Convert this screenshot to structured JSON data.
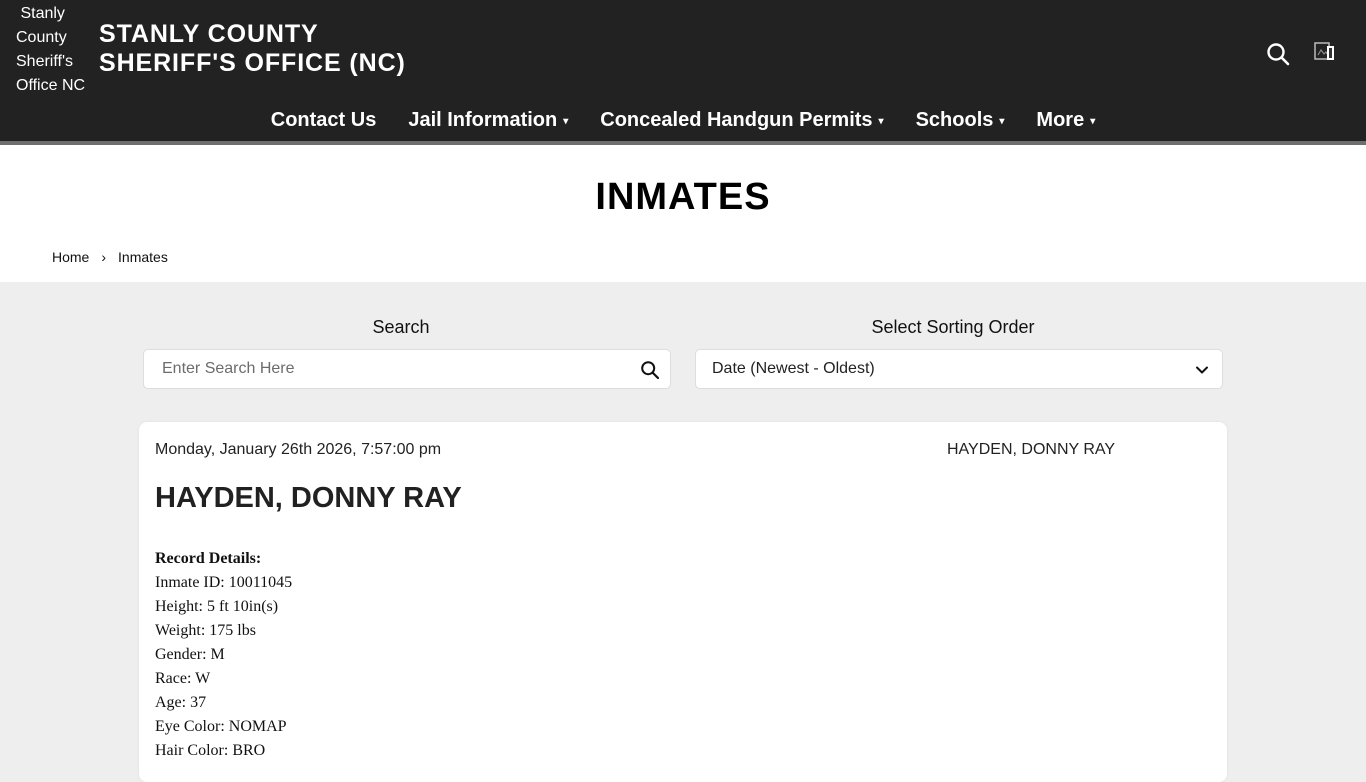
{
  "header": {
    "logo_alt": "Stanly County Sheriff's Office NC",
    "title_line1": "STANLY COUNTY",
    "title_line2": "SHERIFF'S OFFICE (NC)"
  },
  "nav": {
    "items": [
      {
        "label": "Contact Us",
        "has_caret": false
      },
      {
        "label": "Jail Information",
        "has_caret": true
      },
      {
        "label": "Concealed Handgun Permits",
        "has_caret": true
      },
      {
        "label": "Schools",
        "has_caret": true
      },
      {
        "label": "More",
        "has_caret": true
      }
    ],
    "caret": "▾"
  },
  "page": {
    "title": "INMATES"
  },
  "breadcrumb": {
    "home": "Home",
    "separator": "›",
    "current": "Inmates"
  },
  "search": {
    "label": "Search",
    "placeholder": "Enter Search Here"
  },
  "sort": {
    "label": "Select Sorting Order",
    "selected": "Date (Newest - Oldest)"
  },
  "record": {
    "date": "Monday, January 26th 2026, 7:57:00 pm",
    "photo_alt": "HAYDEN, DONNY RAY",
    "name": "HAYDEN, DONNY RAY",
    "details_heading": "Record Details:",
    "details": [
      "Inmate ID: 10011045",
      "Height: 5 ft 10in(s)",
      "Weight: 175 lbs",
      "Gender: M",
      "Race: W",
      "Age: 37",
      "Eye Color: NOMAP",
      "Hair Color: BRO"
    ]
  },
  "colors": {
    "header_bg": "#222222",
    "page_bg": "#eeeeee",
    "card_bg": "#ffffff"
  },
  "icons": {
    "search": "search-icon",
    "language": "broken-image-icon",
    "sort_chevron": "chevron-down-icon"
  }
}
